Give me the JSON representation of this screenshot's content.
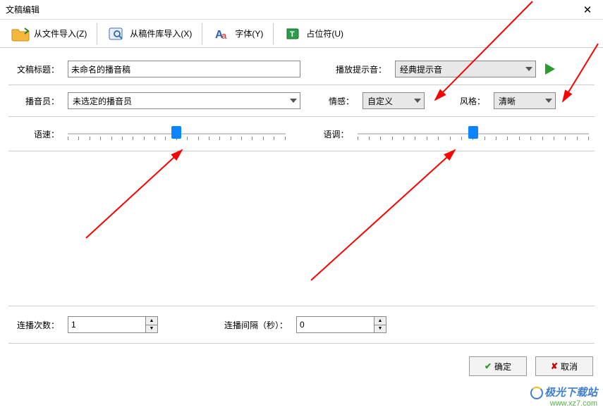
{
  "window": {
    "title": "文稿编辑",
    "close": "✕"
  },
  "toolbar": {
    "item1": "从文件导入(Z)",
    "item2": "从稿件库导入(X)",
    "item3": "字体(Y)",
    "item4": "占位符(U)"
  },
  "row1": {
    "title_label": "文稿标题：",
    "title_value": "未命名的播音稿",
    "play_hint_label": "播放提示音：",
    "play_hint_value": "经典提示音"
  },
  "row2": {
    "announcer_label": "播音员：",
    "announcer_value": "未选定的播音员",
    "emotion_label": "情感：",
    "emotion_value": "自定义",
    "style_label": "风格：",
    "style_value": "清晰"
  },
  "row3": {
    "speed_label": "语速：",
    "tone_label": "语调："
  },
  "bottom": {
    "repeat_label": "连播次数：",
    "repeat_value": "1",
    "gap_label": "连播间隔（秒）：",
    "gap_value": "0"
  },
  "footer": {
    "ok": "确定",
    "cancel": "取消"
  },
  "watermark": {
    "brand": "极光下载站",
    "url": "www.xz7.com"
  },
  "icons": {
    "folder": "folder-import-icon",
    "library": "library-import-icon",
    "font": "font-icon",
    "placeholder": "placeholder-icon",
    "play": "play-icon",
    "chevron": "chevron-down-icon"
  }
}
